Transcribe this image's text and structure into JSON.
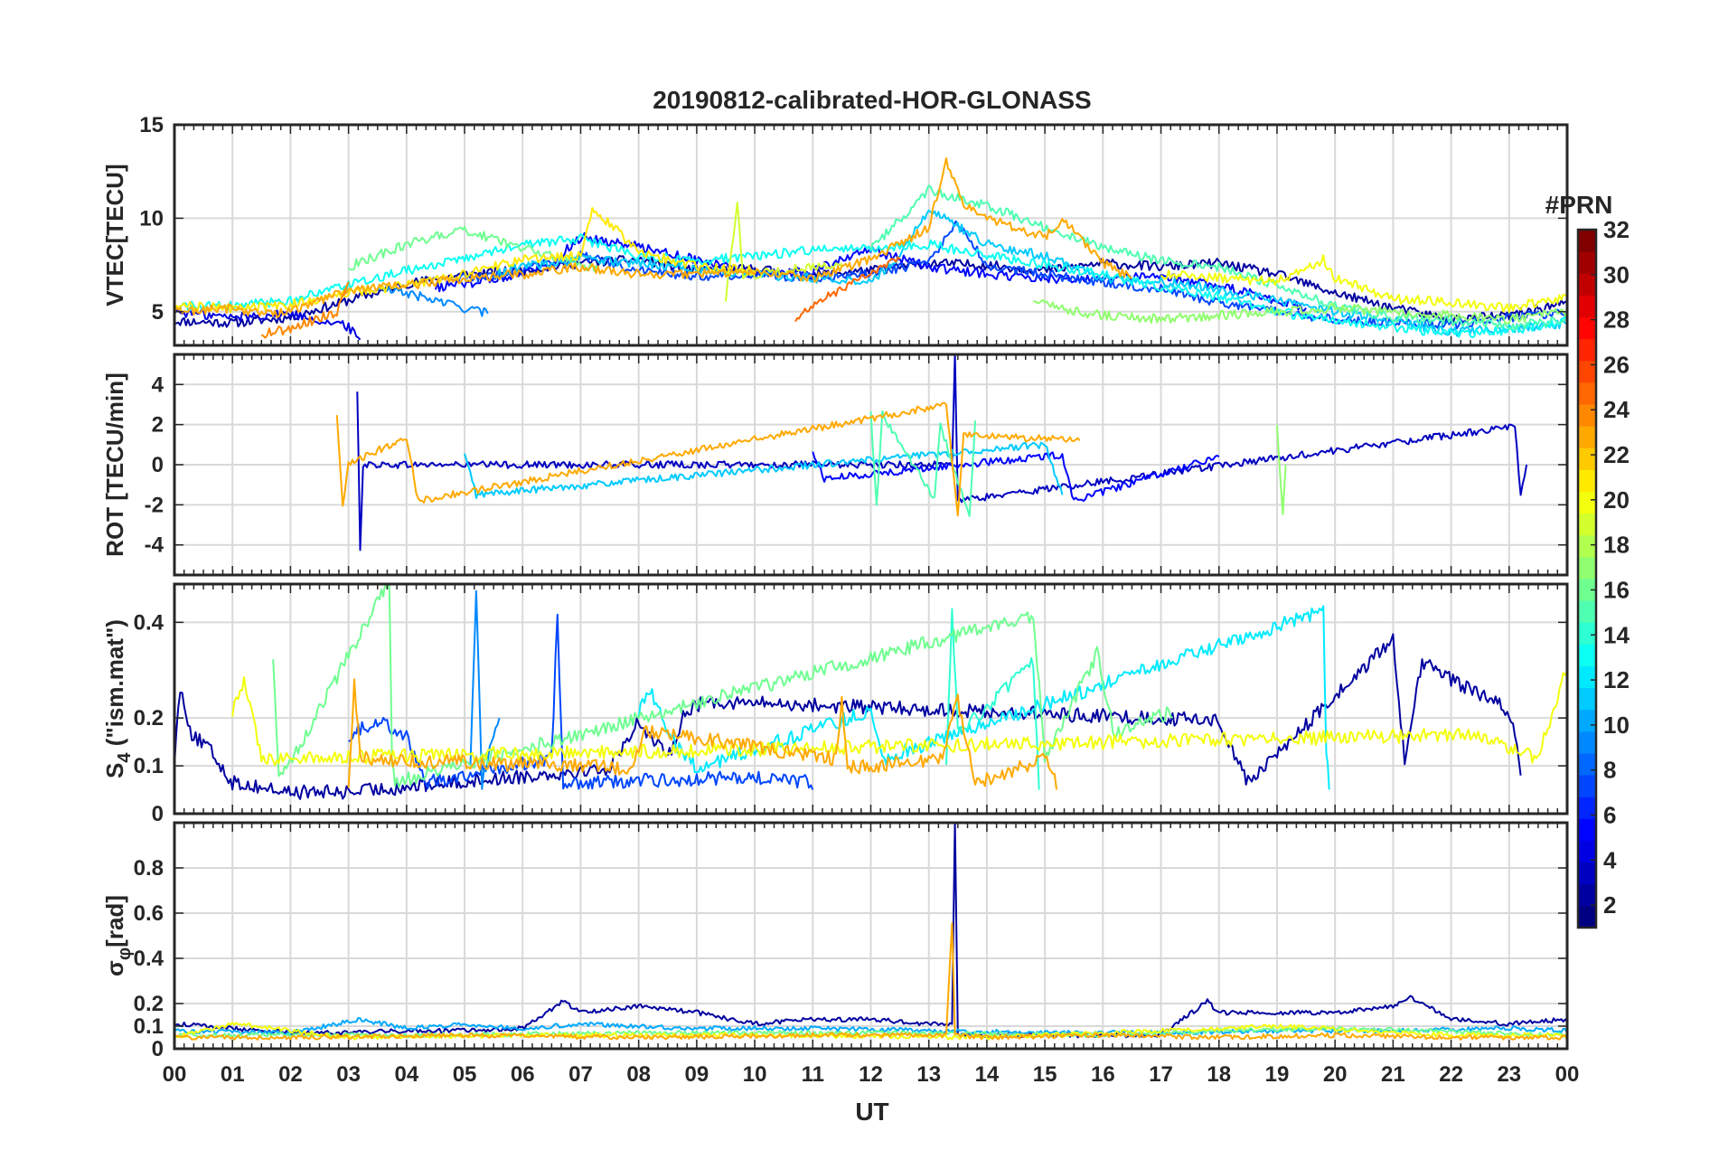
{
  "figure": {
    "title": "20190812-calibrated-HOR-GLONASS",
    "xlabel": "UT",
    "x_tick_labels": [
      "00",
      "01",
      "02",
      "03",
      "04",
      "05",
      "06",
      "07",
      "08",
      "09",
      "10",
      "11",
      "12",
      "13",
      "14",
      "15",
      "16",
      "17",
      "18",
      "19",
      "20",
      "21",
      "22",
      "23",
      "00"
    ]
  },
  "colorbar": {
    "title": "#PRN",
    "tick_labels": [
      "2",
      "4",
      "6",
      "8",
      "10",
      "12",
      "14",
      "16",
      "18",
      "20",
      "22",
      "24",
      "26",
      "28",
      "30",
      "32"
    ],
    "range": [
      1,
      32
    ],
    "colormap": "jet"
  },
  "chart_data": [
    {
      "type": "line",
      "panel": "vtec",
      "ylabel": "VTEC[TECU]",
      "ylim": [
        3.2,
        15
      ],
      "yticks": [
        5,
        10,
        15
      ],
      "xlim": [
        0,
        24
      ],
      "grid": true,
      "series": [
        {
          "prn": 2,
          "x": [
            0.0,
            1.0,
            2.0,
            3.0,
            4.0,
            5.0,
            6.0,
            7.0,
            8.0,
            9.0,
            10.0,
            11.0,
            12.0,
            13.0,
            14.0,
            15.0,
            16.0,
            17.0,
            18.0,
            19.0,
            20.0,
            21.0,
            22.0,
            23.0,
            24.0
          ],
          "y": [
            4.5,
            4.4,
            4.7,
            5.6,
            6.5,
            7.0,
            7.2,
            7.6,
            7.8,
            7.2,
            7.3,
            7.0,
            7.2,
            7.6,
            7.5,
            7.2,
            7.6,
            7.4,
            7.6,
            7.0,
            6.0,
            5.2,
            4.6,
            4.8,
            5.5
          ]
        },
        {
          "prn": 4,
          "x": [
            0.0,
            1.0,
            2.0,
            3.0,
            3.2
          ],
          "y": [
            5.0,
            4.7,
            4.9,
            4.2,
            3.5
          ]
        },
        {
          "prn": 5,
          "x": [
            4.5,
            5.5,
            6.5,
            7.0,
            8.0,
            9.0,
            10.0,
            11.0,
            12.0,
            13.0,
            14.0,
            15.0,
            16.0,
            17.0,
            18.0,
            19.0,
            19.5
          ],
          "y": [
            6.3,
            6.7,
            7.6,
            9.0,
            8.5,
            7.8,
            7.0,
            7.2,
            8.3,
            7.4,
            7.0,
            6.8,
            6.7,
            6.9,
            6.4,
            5.6,
            5.2
          ]
        },
        {
          "prn": 7,
          "x": [
            4.8,
            5.5,
            6.0,
            7.0,
            8.0,
            9.0,
            10.0,
            11.0,
            12.0,
            13.0,
            13.5,
            14.0,
            15.0,
            16.0,
            17.0,
            18.0,
            19.0,
            20.0,
            21.0,
            22.0,
            23.0,
            24.0
          ],
          "y": [
            6.8,
            6.9,
            7.3,
            8.0,
            7.2,
            6.9,
            7.0,
            6.8,
            7.1,
            7.6,
            9.8,
            7.5,
            7.0,
            6.6,
            6.2,
            5.5,
            5.0,
            4.6,
            4.4,
            4.3,
            4.7,
            5.0
          ]
        },
        {
          "prn": 9,
          "x": [
            3.5,
            4.0,
            5.0,
            5.4
          ],
          "y": [
            6.2,
            6.0,
            5.2,
            4.9
          ]
        },
        {
          "prn": 11,
          "x": [
            5.5,
            6.0,
            7.0,
            8.0,
            9.0,
            10.0,
            11.0,
            12.0,
            12.5,
            13.0,
            14.0,
            15.0,
            16.0,
            17.0,
            18.0,
            19.0,
            20.0,
            21.0,
            22.0,
            23.0,
            24.0
          ],
          "y": [
            7.0,
            7.4,
            7.8,
            7.6,
            7.3,
            7.0,
            6.8,
            6.6,
            8.0,
            10.5,
            8.6,
            8.0,
            6.8,
            6.6,
            6.2,
            5.6,
            5.0,
            4.5,
            3.9,
            4.1,
            4.4
          ]
        },
        {
          "prn": 13,
          "x": [
            0.0,
            1.0,
            2.0,
            3.0,
            4.0,
            5.0,
            6.0,
            7.0,
            8.0,
            9.0,
            10.0,
            11.0,
            12.0,
            13.0,
            14.0,
            15.0,
            16.0,
            17.0,
            18.0,
            19.0,
            20.0,
            21.0,
            22.0,
            23.0,
            24.0
          ],
          "y": [
            5.3,
            5.3,
            5.6,
            6.4,
            7.2,
            7.8,
            8.6,
            8.9,
            8.0,
            7.7,
            8.0,
            8.3,
            8.4,
            8.6,
            8.0,
            7.5,
            7.0,
            6.3,
            5.8,
            5.0,
            4.5,
            4.2,
            3.8,
            4.0,
            4.5
          ]
        },
        {
          "prn": 15,
          "x": [
            12.0,
            13.0,
            14.0,
            15.0,
            16.0,
            17.0,
            18.0,
            19.0,
            20.0,
            21.0,
            22.0,
            23.0,
            24.0
          ],
          "y": [
            8.4,
            11.5,
            10.7,
            9.5,
            8.5,
            7.7,
            7.4,
            6.4,
            5.3,
            4.7,
            4.5,
            4.2,
            4.6
          ]
        },
        {
          "prn": 16,
          "x": [
            3.0,
            4.0,
            5.0,
            6.0,
            7.0,
            7.3
          ],
          "y": [
            7.4,
            8.6,
            9.4,
            8.4,
            7.6,
            7.2
          ]
        },
        {
          "prn": 17,
          "x": [
            14.8,
            15.5,
            16.0,
            17.0,
            18.0,
            19.0,
            20.0,
            21.0,
            22.0,
            23.0,
            24.0
          ],
          "y": [
            5.6,
            5.0,
            4.8,
            4.6,
            4.8,
            5.0,
            5.2,
            5.0,
            4.8,
            4.6,
            5.0
          ]
        },
        {
          "prn": 19,
          "x": [
            9.5,
            9.7,
            9.8,
            10.0,
            11.0,
            11.5
          ],
          "y": [
            5.6,
            10.8,
            6.8,
            7.0,
            7.4,
            7.6
          ]
        },
        {
          "prn": 20,
          "x": [
            17.0,
            18.0,
            19.0,
            19.8,
            20.0,
            21.0,
            22.0,
            23.0,
            24.0
          ],
          "y": [
            7.0,
            6.8,
            6.6,
            7.8,
            6.8,
            5.7,
            5.5,
            5.2,
            5.8
          ]
        },
        {
          "prn": 21,
          "x": [
            0.0,
            1.0,
            2.0,
            3.0,
            4.0,
            5.0,
            6.0,
            7.0,
            7.2,
            8.0,
            9.0,
            10.0
          ],
          "y": [
            5.3,
            5.2,
            5.4,
            6.0,
            6.4,
            7.0,
            7.8,
            8.0,
            10.6,
            8.2,
            7.4,
            7.2
          ]
        },
        {
          "prn": 23,
          "x": [
            0.0,
            1.0,
            1.5,
            2.0,
            3.0,
            4.0,
            5.0,
            6.0,
            7.0,
            8.0,
            9.0,
            10.0,
            11.0,
            12.0,
            13.0,
            13.3,
            13.6,
            14.0,
            15.0,
            15.3,
            16.0,
            16.5
          ],
          "y": [
            5.0,
            5.2,
            4.9,
            5.0,
            6.2,
            6.4,
            6.8,
            7.0,
            7.4,
            7.0,
            7.0,
            7.2,
            6.8,
            7.8,
            9.5,
            13.0,
            10.8,
            10.0,
            9.0,
            10.0,
            7.6,
            6.8
          ]
        },
        {
          "prn": 24,
          "x": [
            1.5,
            2.0,
            2.8,
            3.0
          ],
          "y": [
            3.8,
            4.1,
            5.0,
            6.6
          ]
        },
        {
          "prn": 25,
          "x": [
            10.7,
            11.0,
            12.0,
            12.5
          ],
          "y": [
            4.5,
            5.4,
            7.0,
            7.8
          ]
        }
      ]
    },
    {
      "type": "line",
      "panel": "rot",
      "ylabel": "ROT [TECU/min]",
      "ylim": [
        -5.5,
        5.5
      ],
      "yticks": [
        -4,
        -2,
        0,
        2,
        4
      ],
      "xlim": [
        0,
        24
      ],
      "grid": true,
      "series": [
        {
          "prn": 3,
          "x": [
            3.15,
            3.2,
            3.25,
            13.4,
            13.45,
            13.5,
            23.1,
            23.2,
            23.3
          ],
          "y": [
            3.6,
            -4.1,
            0.0,
            0.0,
            5.4,
            -1.8,
            1.9,
            -1.5,
            0.0
          ]
        },
        {
          "prn": 5,
          "x": [
            11.0,
            11.2,
            15.3,
            15.5,
            18.0
          ],
          "y": [
            0.6,
            -0.7,
            0.5,
            -1.8,
            0.4
          ]
        },
        {
          "prn": 11,
          "x": [
            5.0,
            5.2,
            15.0,
            15.3
          ],
          "y": [
            0.5,
            -1.5,
            1.0,
            -1.5
          ]
        },
        {
          "prn": 15,
          "x": [
            12.0,
            12.1,
            12.2,
            13.1,
            13.2,
            13.7,
            13.8
          ],
          "y": [
            2.6,
            -1.9,
            2.5,
            -1.7,
            2.0,
            -2.7,
            2.2
          ]
        },
        {
          "prn": 17,
          "x": [
            19.0,
            19.1,
            19.15
          ],
          "y": [
            1.9,
            -2.5,
            0.0
          ]
        },
        {
          "prn": 23,
          "x": [
            2.8,
            2.9,
            3.0,
            4.0,
            4.2,
            13.3,
            13.5,
            13.6,
            15.6
          ],
          "y": [
            2.4,
            -2.2,
            0.0,
            1.4,
            -1.8,
            3.0,
            -2.6,
            1.5,
            1.2
          ]
        }
      ]
    },
    {
      "type": "line",
      "panel": "s4",
      "ylabel": "S_4 (\"ism.mat\")",
      "ylim": [
        0,
        0.48
      ],
      "yticks": [
        0,
        0.1,
        0.2,
        0.4
      ],
      "ytick_labels": [
        "0",
        "0.1",
        "0.2",
        "0.4"
      ],
      "xlim": [
        0,
        24
      ],
      "grid": true,
      "series": [
        {
          "prn": 2,
          "x": [
            0.0,
            0.1,
            0.3,
            0.6,
            1.0,
            2.0,
            3.0,
            7.5,
            8.0,
            8.5,
            8.8,
            9.2,
            18.0,
            18.5,
            21.0,
            21.2,
            21.5,
            23.0,
            23.2
          ],
          "y": [
            0.1,
            0.25,
            0.15,
            0.12,
            0.05,
            0.03,
            0.03,
            0.08,
            0.18,
            0.1,
            0.2,
            0.22,
            0.18,
            0.05,
            0.35,
            0.1,
            0.3,
            0.2,
            0.08
          ]
        },
        {
          "prn": 7,
          "x": [
            3.0,
            3.5,
            4.0,
            4.3,
            6.5,
            6.6,
            6.7,
            10.0,
            11.0
          ],
          "y": [
            0.15,
            0.18,
            0.15,
            0.05,
            0.1,
            0.4,
            0.05,
            0.06,
            0.05
          ]
        },
        {
          "prn": 9,
          "x": [
            5.1,
            5.2,
            5.3,
            5.6
          ],
          "y": [
            0.1,
            0.44,
            0.05,
            0.2
          ]
        },
        {
          "prn": 12,
          "x": [
            8.0,
            8.2,
            8.5,
            9.0,
            12.0,
            12.2,
            19.8,
            19.85,
            19.9
          ],
          "y": [
            0.2,
            0.25,
            0.15,
            0.08,
            0.2,
            0.1,
            0.41,
            0.1,
            0.05
          ]
        },
        {
          "prn": 14,
          "x": [
            13.3,
            13.4,
            13.5,
            14.8,
            14.9
          ],
          "y": [
            0.1,
            0.41,
            0.15,
            0.3,
            0.05
          ]
        },
        {
          "prn": 16,
          "x": [
            1.7,
            1.8,
            3.7,
            3.75,
            3.8,
            14.8,
            15.0,
            15.9,
            16.2,
            17.2
          ],
          "y": [
            0.32,
            0.05,
            0.47,
            0.1,
            0.05,
            0.4,
            0.1,
            0.32,
            0.15,
            0.2
          ]
        },
        {
          "prn": 20,
          "x": [
            1.0,
            1.2,
            1.5,
            22.5,
            23.5,
            24.0
          ],
          "y": [
            0.2,
            0.26,
            0.1,
            0.15,
            0.1,
            0.3
          ]
        },
        {
          "prn": 23,
          "x": [
            3.0,
            3.1,
            3.2,
            7.9,
            8.1,
            11.4,
            11.5,
            11.6,
            13.2,
            13.5,
            13.8,
            15.0,
            15.2
          ],
          "y": [
            0.05,
            0.26,
            0.1,
            0.08,
            0.16,
            0.1,
            0.22,
            0.08,
            0.1,
            0.22,
            0.05,
            0.1,
            0.05
          ]
        }
      ]
    },
    {
      "type": "line",
      "panel": "sigma_phi",
      "ylabel": "σ_φ[rad]",
      "ylim": [
        0,
        1
      ],
      "yticks": [
        0,
        0.1,
        0.2,
        0.4,
        0.6,
        0.8
      ],
      "ytick_labels": [
        "0",
        "0.1",
        "0.2",
        "0.4",
        "0.6",
        "0.8"
      ],
      "xlim": [
        0,
        24
      ],
      "grid": true,
      "series": [
        {
          "prn": 2,
          "x": [
            0.0,
            1.0,
            2.0,
            3.0,
            4.0,
            5.0,
            6.0,
            6.7,
            7.0,
            8.0,
            9.0,
            10.0,
            11.0,
            12.0,
            13.0,
            13.4,
            13.45,
            13.5,
            14.0,
            15.0,
            16.0,
            17.0,
            17.8,
            18.0,
            19.0,
            20.0,
            21.0,
            21.3,
            22.0,
            23.0,
            24.0
          ],
          "y": [
            0.1,
            0.08,
            0.06,
            0.06,
            0.07,
            0.07,
            0.08,
            0.2,
            0.15,
            0.18,
            0.15,
            0.1,
            0.12,
            0.12,
            0.1,
            0.1,
            1.0,
            0.05,
            0.05,
            0.05,
            0.05,
            0.05,
            0.2,
            0.15,
            0.15,
            0.15,
            0.18,
            0.22,
            0.12,
            0.1,
            0.12
          ]
        },
        {
          "prn": 10,
          "x": [
            0.0,
            2.0,
            3.2,
            4.0,
            5.0,
            6.0,
            7.0,
            9.0,
            11.0,
            13.0,
            15.0,
            17.0,
            19.0,
            21.0,
            23.0,
            24.0
          ],
          "y": [
            0.07,
            0.06,
            0.12,
            0.08,
            0.1,
            0.08,
            0.1,
            0.08,
            0.08,
            0.07,
            0.06,
            0.06,
            0.07,
            0.07,
            0.08,
            0.07
          ]
        },
        {
          "prn": 16,
          "x": [
            0.0,
            4.0,
            8.0,
            12.0,
            16.0,
            18.0,
            20.0,
            24.0
          ],
          "y": [
            0.05,
            0.05,
            0.06,
            0.06,
            0.05,
            0.07,
            0.08,
            0.05
          ]
        },
        {
          "prn": 20,
          "x": [
            0.0,
            1.0,
            3.0,
            6.0,
            10.0,
            14.0,
            19.0,
            22.0,
            24.0
          ],
          "y": [
            0.04,
            0.1,
            0.04,
            0.05,
            0.05,
            0.04,
            0.09,
            0.05,
            0.05
          ]
        },
        {
          "prn": 23,
          "x": [
            0.0,
            2.0,
            5.0,
            8.0,
            11.0,
            13.3,
            13.4,
            13.45,
            14.0,
            16.0,
            18.0,
            20.0,
            22.0,
            24.0
          ],
          "y": [
            0.04,
            0.04,
            0.05,
            0.04,
            0.05,
            0.05,
            0.55,
            0.05,
            0.04,
            0.05,
            0.04,
            0.05,
            0.04,
            0.04
          ]
        }
      ]
    }
  ]
}
